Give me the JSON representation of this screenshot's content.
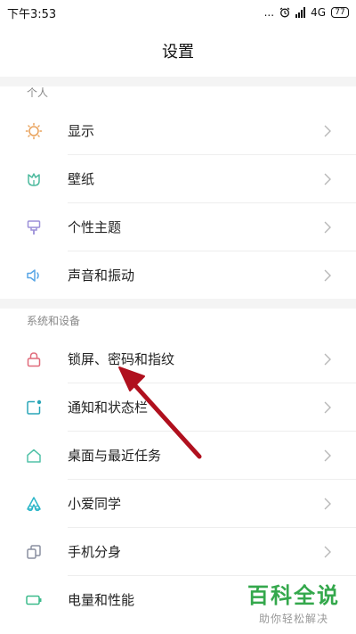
{
  "status": {
    "time": "下午3:53",
    "more": "...",
    "network": "4G",
    "battery": "77"
  },
  "header": {
    "title": "设置"
  },
  "sections": [
    {
      "label": "个人",
      "items": [
        {
          "label": "显示",
          "icon": "sun-icon"
        },
        {
          "label": "壁纸",
          "icon": "wallpaper-icon"
        },
        {
          "label": "个性主题",
          "icon": "theme-brush-icon"
        },
        {
          "label": "声音和振动",
          "icon": "speaker-icon"
        }
      ]
    },
    {
      "label": "系统和设备",
      "items": [
        {
          "label": "锁屏、密码和指纹",
          "icon": "lock-icon"
        },
        {
          "label": "通知和状态栏",
          "icon": "notification-icon"
        },
        {
          "label": "桌面与最近任务",
          "icon": "home-icon"
        },
        {
          "label": "小爱同学",
          "icon": "xiaoai-icon"
        },
        {
          "label": "手机分身",
          "icon": "clone-icon"
        },
        {
          "label": "电量和性能",
          "icon": "battery-icon"
        }
      ]
    }
  ],
  "watermark": {
    "title": "百科全说",
    "subtitle": "助你轻松解决"
  },
  "colors": {
    "sun": "#e9a25b",
    "wallpaper": "#4dba9e",
    "theme": "#9b8fd8",
    "speaker": "#58a6e6",
    "lock": "#e06a7a",
    "notification": "#2aa6b8",
    "home": "#52c2a8",
    "xiaoai": "#2cb6c8",
    "clone": "#8a8fa0",
    "battery": "#3dbb8c",
    "arrow": "#b0101e",
    "watermark": "#34a84c"
  }
}
